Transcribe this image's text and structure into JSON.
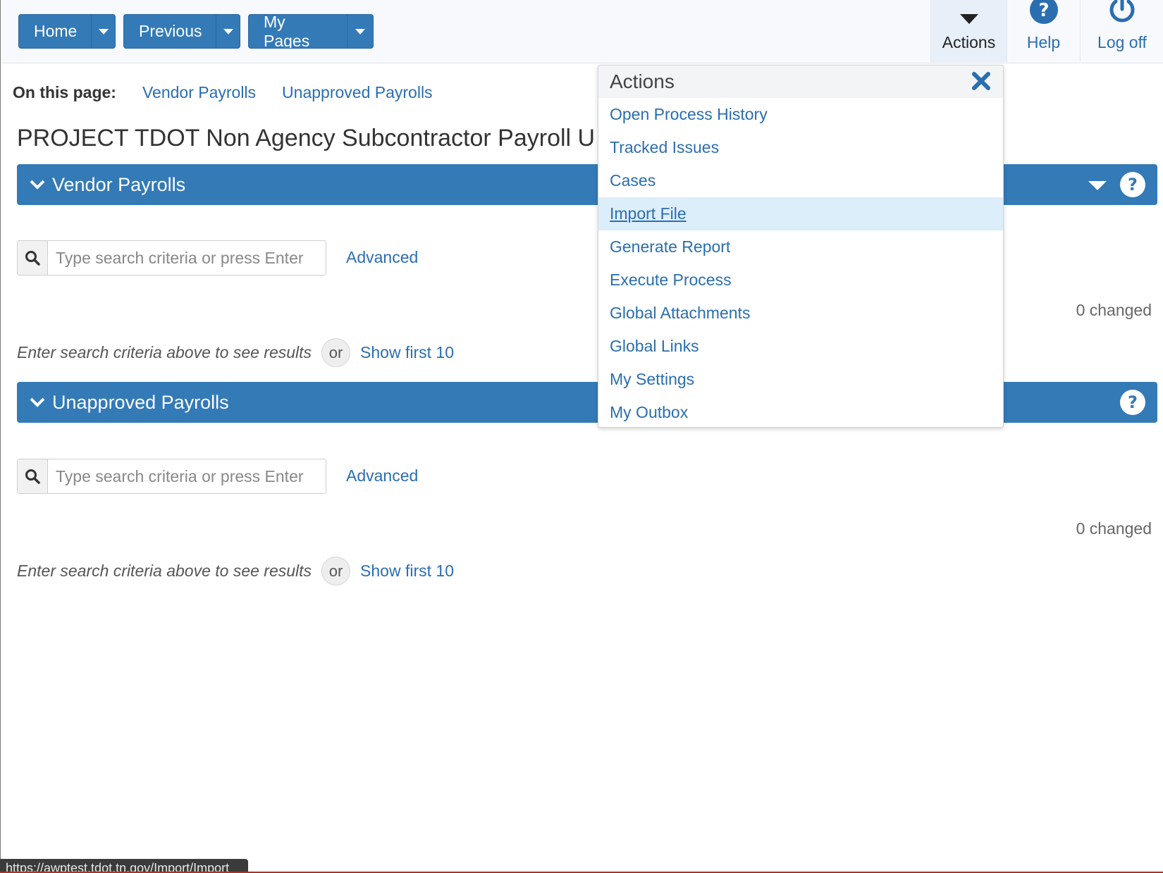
{
  "nav": {
    "home_label": "Home",
    "previous_label": "Previous",
    "mypages_label": "My Pages"
  },
  "toolbar": {
    "actions_label": "Actions",
    "help_label": "Help",
    "logoff_label": "Log off"
  },
  "on_this_page": {
    "label": "On this page:",
    "links": [
      "Vendor Payrolls",
      "Unapproved Payrolls"
    ]
  },
  "page": {
    "title": "PROJECT TDOT Non Agency Subcontractor Payroll U"
  },
  "panels": [
    {
      "title": "Vendor Payrolls",
      "search_placeholder": "Type search criteria or press Enter",
      "advanced_label": "Advanced",
      "changed_text": "0 changed",
      "hint_text": "Enter search criteria above to see results",
      "or_text": "or",
      "show_first_label": "Show first 10"
    },
    {
      "title": "Unapproved Payrolls",
      "search_placeholder": "Type search criteria or press Enter",
      "advanced_label": "Advanced",
      "changed_text": "0 changed",
      "hint_text": "Enter search criteria above to see results",
      "or_text": "or",
      "show_first_label": "Show first 10"
    }
  ],
  "actions_menu": {
    "title": "Actions",
    "items": [
      "Open Process History",
      "Tracked Issues",
      "Cases",
      "Import File",
      "Generate Report",
      "Execute Process",
      "Global Attachments",
      "Global Links",
      "My Settings",
      "My Outbox"
    ],
    "hovered_item": "Import File"
  },
  "status_bar": {
    "url": "https://awptest.tdot.tn.gov/Import/Import"
  },
  "colors": {
    "primary": "#337ab7",
    "link": "#2a6eb0",
    "hover_bg": "#ddeefb"
  }
}
